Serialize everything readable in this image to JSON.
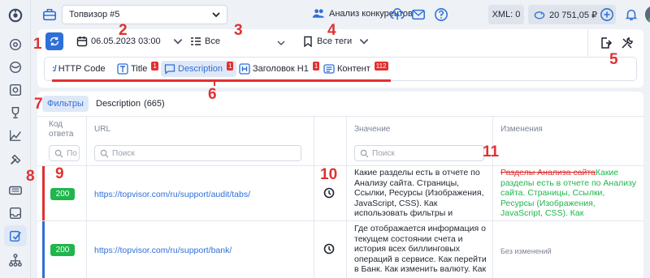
{
  "topbar": {
    "project_name": "Топвизор #5",
    "competitors_label": "Анализ конкурентов",
    "xml_label": "XML: 0",
    "balance": "20 751,05 ₽"
  },
  "filters": {
    "date_value": "06.05.2023 03:00",
    "group_value": "Все",
    "tags_value": "Все теги"
  },
  "tabs": [
    {
      "label": "HTTP Code",
      "badge": ""
    },
    {
      "label": "Title",
      "badge": "1"
    },
    {
      "label": "Description",
      "badge": "1"
    },
    {
      "label": "Заголовок H1",
      "badge": "1"
    },
    {
      "label": "Контент",
      "badge": "112"
    }
  ],
  "subtabs": {
    "filters_label": "Фильтры",
    "current_label": "Description",
    "current_count": "(665)"
  },
  "table": {
    "headers": {
      "code": "Код ответа",
      "url": "URL",
      "value": "Значение",
      "changes": "Изменения"
    },
    "search_placeholder": "Поиск",
    "search_placeholder_short": "По",
    "rows": [
      {
        "code": "200",
        "url": "https://topvisor.com/ru/support/audit/tabs/",
        "value": "Какие разделы есть в отчете по Анализу сайта. Страницы, Ссылки, Ресурсы (Изображения, JavaScript, CSS). Как использовать фильтры и сортировки. Как посмотреть",
        "change_deleted": "Разделы Анализа сайта",
        "change_inserted": "Какие разделы есть в отчете по Анализу сайта. Страницы, Ссылки, Ресурсы (Изображения, JavaScript, CSS). Как использовать фильтры и",
        "bar_color": "#e03131"
      },
      {
        "code": "200",
        "url": "https://topvisor.com/ru/support/bank/",
        "value": "Где отображается информация о текущем состоянии счета и история всех биллинговых операций в сервисе. Как перейти в Банк. Как изменить валюту. Как применить",
        "change_none": "Без изменений",
        "bar_color": "#2e6fd8"
      }
    ]
  },
  "annotations": [
    "1",
    "2",
    "3",
    "4",
    "5",
    "6",
    "7",
    "8",
    "9",
    "10",
    "11"
  ],
  "colors": {
    "accent": "#2e6fd8",
    "annotation": "#e03131",
    "status_ok": "#1fb64c"
  }
}
